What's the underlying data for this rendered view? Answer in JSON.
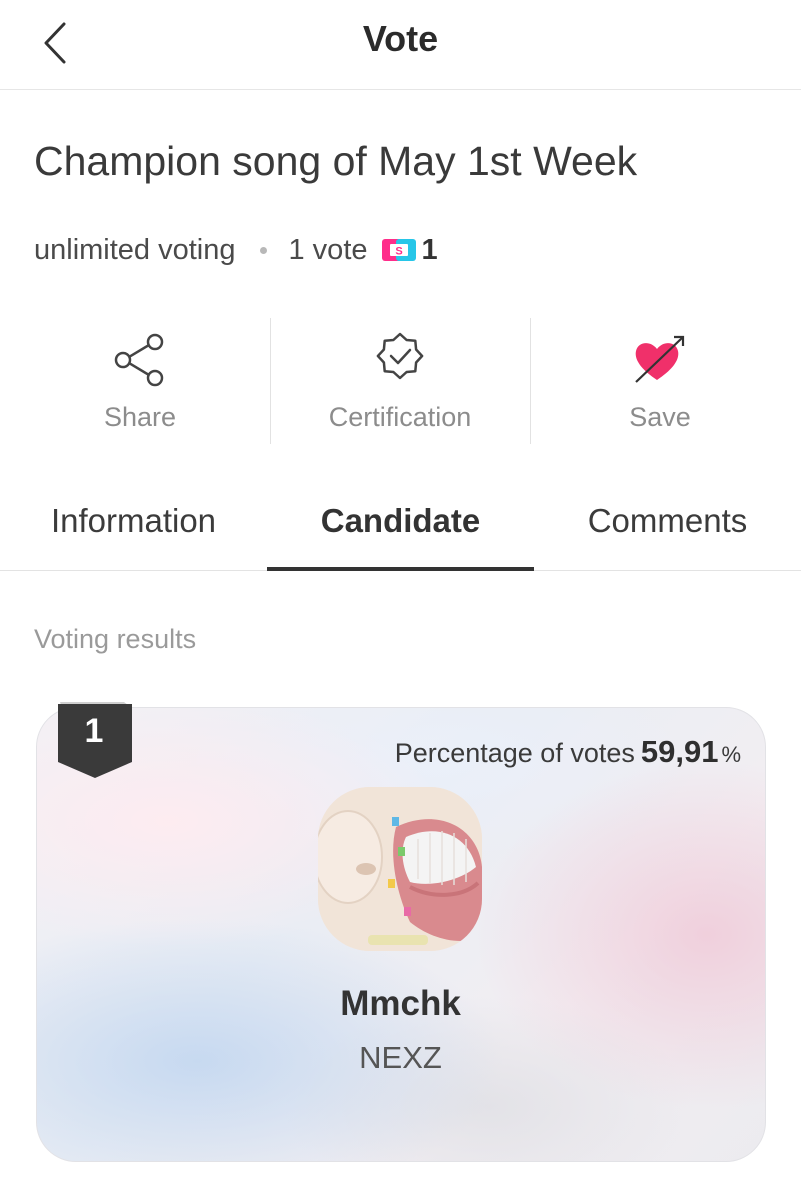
{
  "header": {
    "title": "Vote",
    "back_icon": "chevron-left-icon"
  },
  "vote": {
    "title": "Champion song of May 1st Week",
    "voting_type": "unlimited voting",
    "cost": "1 vote",
    "coin_icon": "star-coin-icon",
    "coin_count": "1"
  },
  "actions": [
    {
      "label": "Share",
      "icon": "share-icon"
    },
    {
      "label": "Certification",
      "icon": "certification-badge-icon"
    },
    {
      "label": "Save",
      "icon": "heart-arrow-icon"
    }
  ],
  "tabs": [
    {
      "label": "Information",
      "active": false
    },
    {
      "label": "Candidate",
      "active": true
    },
    {
      "label": "Comments",
      "active": false
    }
  ],
  "results": {
    "section_label": "Voting results",
    "candidates": [
      {
        "rank": "1",
        "percentage_label": "Percentage of votes",
        "percentage_value": "59,91",
        "percentage_unit": "%",
        "song": "Mmchk",
        "artist": "NEXZ"
      }
    ]
  },
  "colors": {
    "accent_pink": "#f0306a",
    "badge_dark": "#3a3a3a",
    "coin_pink": "#ff2d8a",
    "coin_cyan": "#27c6e8"
  }
}
